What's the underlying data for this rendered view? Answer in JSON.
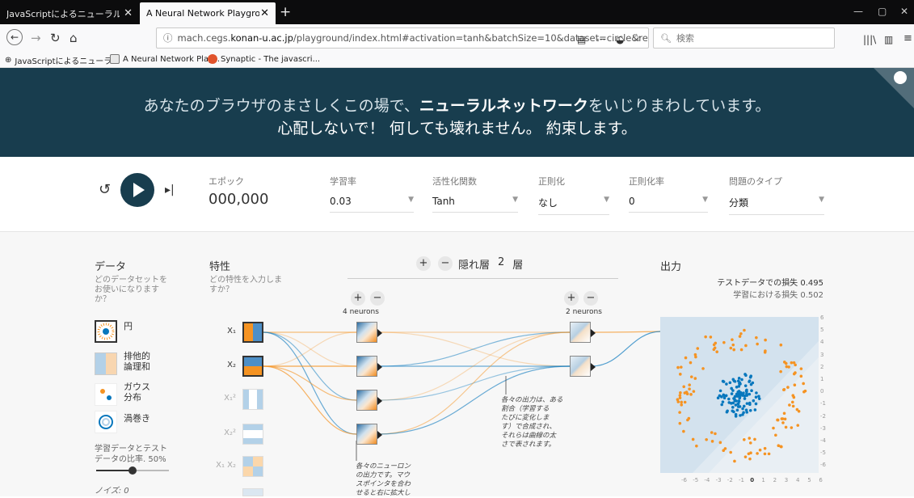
{
  "browser": {
    "tabs": [
      {
        "title": "JavaScriptによるニューラルネットワーク作",
        "active": false
      },
      {
        "title": "A Neural Network Playground",
        "active": true
      }
    ],
    "url_prefix": "mach.cegs.",
    "url_domain": "konan-u.ac.jp",
    "url_rest": "/playground/index.html#activation=tanh&batchSize=10&dataset=circle&regD",
    "search_placeholder": "検索",
    "bookmarks": [
      "JavaScriptによるニューラ...",
      "A Neural Network Play...",
      "Synaptic - The javascri..."
    ]
  },
  "hero": {
    "line1_a": "あなたのブラウザのまさしくこの場で、",
    "line1_b": "ニューラルネットワーク",
    "line1_c": "をいじりまわしています。",
    "line2": "心配しないで！ 何しても壊れません。 約束します。"
  },
  "controls": {
    "epoch_label": "エポック",
    "epoch_value": "000,000",
    "learning_rate_label": "学習率",
    "learning_rate_value": "0.03",
    "activation_label": "活性化関数",
    "activation_value": "Tanh",
    "regularization_label": "正則化",
    "regularization_value": "なし",
    "reg_rate_label": "正則化率",
    "reg_rate_value": "0",
    "problem_label": "問題のタイプ",
    "problem_value": "分類"
  },
  "data_panel": {
    "title": "データ",
    "desc": [
      "どのデータセットを",
      "お使いになります",
      "か？"
    ],
    "datasets": [
      "円",
      "排他的",
      "論理和",
      "ガウス",
      "分布",
      "渦巻き"
    ],
    "ratio_label_1": "学習データとテスト",
    "ratio_label_2": "データの比率.  50%",
    "noise_label": "ノイズ: 0"
  },
  "features_panel": {
    "title": "特性",
    "desc": [
      "どの特性を入力しま",
      "すか？"
    ],
    "features": [
      "X₁",
      "X₂",
      "X₁²",
      "X₂²",
      "X₁ X₂"
    ]
  },
  "hidden": {
    "label": "隠れ層",
    "count": "2",
    "unit": "層",
    "layer1": "4 neurons",
    "layer2": "2 neurons",
    "note1": [
      "各々の出力は、ある",
      "割合（学習する",
      "たびに変化しま",
      "す）で合成され、",
      "それらは曲線の太",
      "さで表されます。"
    ],
    "note2": [
      "各々のニューロン",
      "の出力です。マウ",
      "スポインタを合わ",
      "せると右に拡大し"
    ]
  },
  "output": {
    "title": "出力",
    "test_loss": "テストデータでの損失 0.495",
    "train_loss": "学習における損失 0.502",
    "y_ticks": [
      "6",
      "5",
      "4",
      "3",
      "2",
      "1",
      "0",
      "-1",
      "-2",
      "-3",
      "-4",
      "-5",
      "-6"
    ],
    "x_ticks": [
      "-6",
      "-5",
      "-4",
      "-3",
      "-2",
      "-1",
      "0",
      "1",
      "2",
      "3",
      "4",
      "5",
      "6"
    ]
  },
  "colors": {
    "header": "#183d4e",
    "orange": "#f59322",
    "blue": "#0877bd"
  }
}
